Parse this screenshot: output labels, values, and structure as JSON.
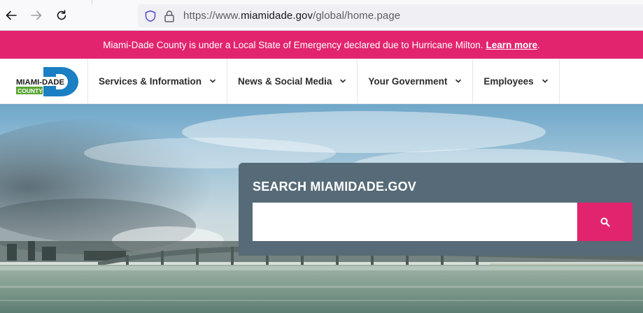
{
  "browser": {
    "url_prefix": "https://www.",
    "url_domain": "miamidade.gov",
    "url_path": "/global/home.page"
  },
  "alert": {
    "message": "Miami-Dade County is under a Local State of Emergency declared due to Hurricane Milton.",
    "link_label": "Learn more",
    "suffix": ".",
    "color": "#e2246e"
  },
  "logo": {
    "line1": "MIAMI-DADE",
    "line2": "COUNTY"
  },
  "nav": {
    "items": [
      {
        "label": "Services & Information"
      },
      {
        "label": "News & Social Media"
      },
      {
        "label": "Your Government"
      },
      {
        "label": "Employees"
      }
    ]
  },
  "search": {
    "title": "SEARCH MIAMIDADE.GOV",
    "placeholder": "",
    "value": "",
    "button_icon": "search-icon",
    "panel_color": "#566a77",
    "button_color": "#e2246e"
  }
}
